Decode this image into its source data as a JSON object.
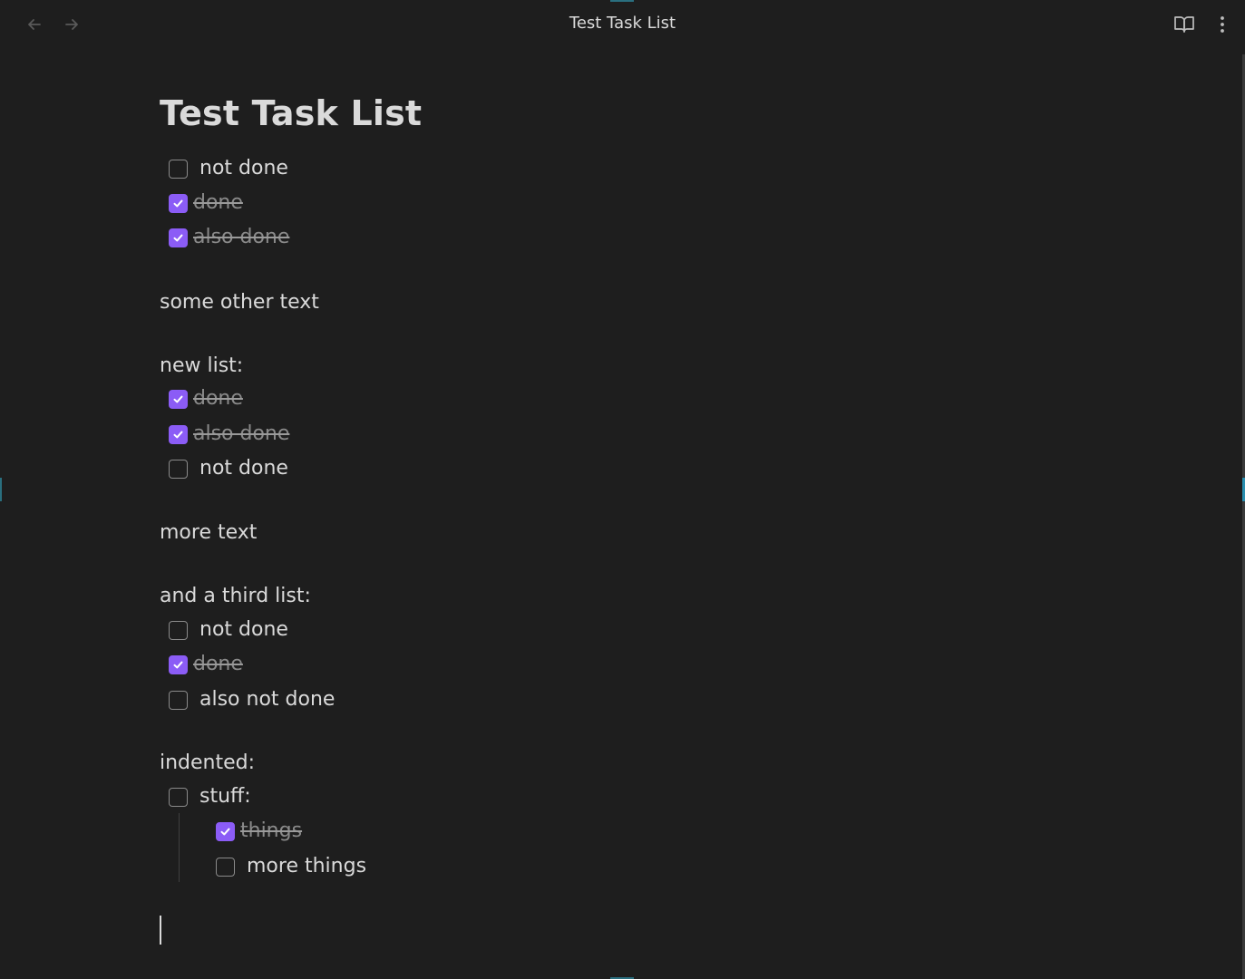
{
  "window": {
    "title": "Test Task List"
  },
  "icons": {
    "back": "arrow-left-icon",
    "forward": "arrow-right-icon",
    "reading_view": "book-open-icon",
    "more": "more-vertical-icon"
  },
  "colors": {
    "background": "#1e1e1e",
    "text": "#dadada",
    "muted_text": "#8a8a8a",
    "accent": "#8b5cf6"
  },
  "note": {
    "heading": "Test Task List",
    "list1": [
      {
        "label": "not done",
        "checked": false
      },
      {
        "label": "done",
        "checked": true
      },
      {
        "label": "also done",
        "checked": true
      }
    ],
    "text1": "some other text",
    "text2": "new list:",
    "list2": [
      {
        "label": "done",
        "checked": true
      },
      {
        "label": "also done",
        "checked": true
      },
      {
        "label": "not done",
        "checked": false
      }
    ],
    "text3": "more text",
    "text4": "and a third list:",
    "list3": [
      {
        "label": "not done",
        "checked": false
      },
      {
        "label": "done",
        "checked": true
      },
      {
        "label": "also not done",
        "checked": false
      }
    ],
    "text5": "indented:",
    "list4": [
      {
        "label": "stuff:",
        "checked": false
      },
      {
        "label": "things",
        "checked": true
      },
      {
        "label": "more things",
        "checked": false
      }
    ]
  }
}
